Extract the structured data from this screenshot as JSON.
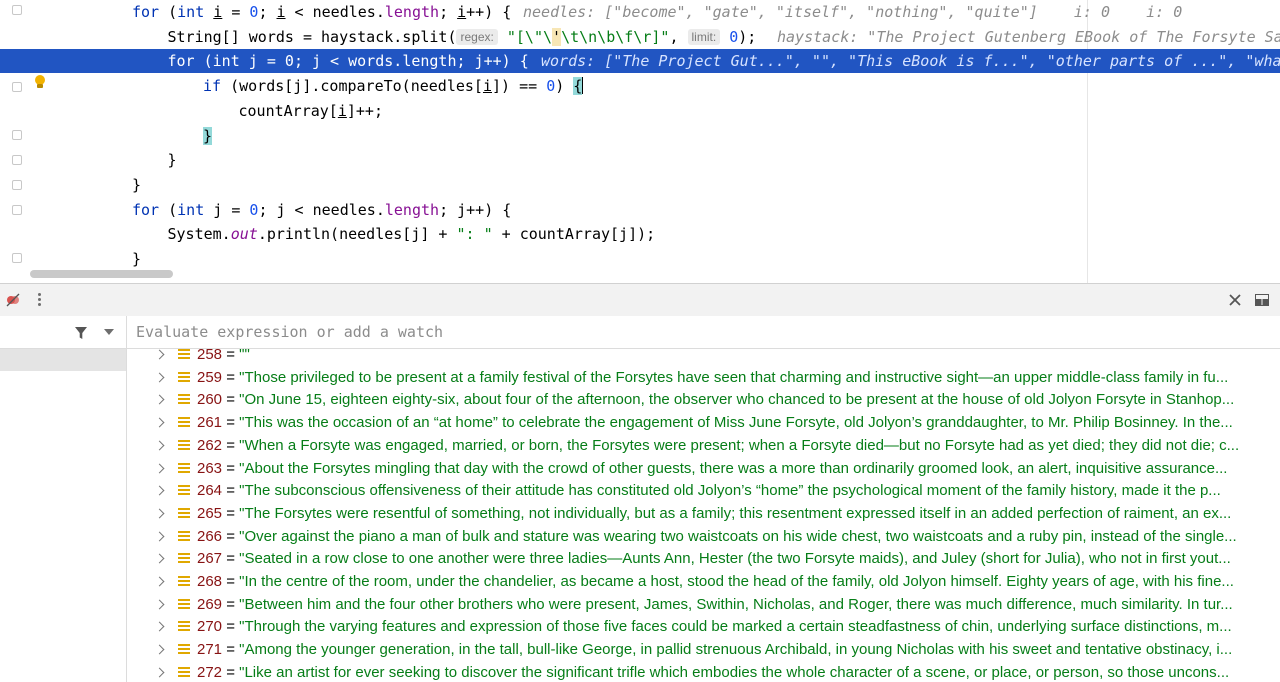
{
  "editor": {
    "lines": [
      {
        "id": "l1",
        "indent": 0,
        "tokens": [
          [
            "kw",
            "for"
          ],
          [
            "t",
            " ("
          ],
          [
            "kw",
            "int "
          ],
          [
            "ul",
            "i"
          ],
          [
            "t",
            " = "
          ],
          [
            "num",
            "0"
          ],
          [
            "t",
            "; "
          ],
          [
            "ul",
            "i"
          ],
          [
            "t",
            " < needles."
          ],
          [
            "fld",
            "length"
          ],
          [
            "t",
            "; "
          ],
          [
            "ul",
            "i"
          ],
          [
            "t",
            "++) {"
          ]
        ],
        "hint": "needles: [\"become\", \"gate\", \"itself\", \"nothing\", \"quite\"]    i: 0    i: 0"
      },
      {
        "id": "l2",
        "indent": 1,
        "tokens": [
          [
            "t",
            "String[] words = haystack.split("
          ],
          [
            "param",
            "regex:"
          ],
          [
            "str",
            " \"[\\\"\\"
          ],
          [
            "esc",
            "'"
          ],
          [
            "str",
            "\\t\\n\\b\\f\\r]\""
          ],
          [
            "t",
            ", "
          ],
          [
            "param",
            "limit:"
          ],
          [
            "t",
            " "
          ],
          [
            "num",
            "0"
          ],
          [
            "t",
            ");"
          ]
        ],
        "hint": "haystack: \"The Project Gutenberg EBook of The Forsyte Saga"
      },
      {
        "id": "l3",
        "indent": 1,
        "tokens": [
          [
            "kw",
            "for"
          ],
          [
            "t",
            " ("
          ],
          [
            "kw",
            "int "
          ],
          [
            "t",
            "j = "
          ],
          [
            "num",
            "0"
          ],
          [
            "t",
            "; j < words."
          ],
          [
            "fld",
            "length"
          ],
          [
            "t",
            "; j++) {"
          ]
        ],
        "hint": "words: [\"The Project Gut...\", \"\", \"This eBook is f...\", \"other parts of ...\", \"whats"
      },
      {
        "id": "l4",
        "indent": 2,
        "tokens": [
          [
            "kw",
            "if"
          ],
          [
            "t",
            " (words[j].compareTo(needles["
          ],
          [
            "ul",
            "i"
          ],
          [
            "t",
            "]) == "
          ],
          [
            "num",
            "0"
          ],
          [
            "t",
            ") "
          ],
          [
            "brace",
            "{"
          ],
          [
            "caret",
            ""
          ]
        ],
        "hint": ""
      },
      {
        "id": "l5",
        "indent": 3,
        "tokens": [
          [
            "t",
            "countArray["
          ],
          [
            "ul",
            "i"
          ],
          [
            "t",
            "]++;"
          ]
        ],
        "hint": ""
      },
      {
        "id": "l6",
        "indent": 2,
        "tokens": [
          [
            "brace",
            "}"
          ]
        ],
        "hint": ""
      },
      {
        "id": "l7",
        "indent": 1,
        "tokens": [
          [
            "t",
            "}"
          ]
        ],
        "hint": ""
      },
      {
        "id": "l8",
        "indent": 0,
        "tokens": [
          [
            "t",
            "}"
          ]
        ],
        "hint": ""
      },
      {
        "id": "l9",
        "indent": 0,
        "tokens": [
          [
            "kw",
            "for"
          ],
          [
            "t",
            " ("
          ],
          [
            "kw",
            "int "
          ],
          [
            "t",
            "j = "
          ],
          [
            "num",
            "0"
          ],
          [
            "t",
            "; j < needles."
          ],
          [
            "fld",
            "length"
          ],
          [
            "t",
            "; j++) {"
          ]
        ],
        "hint": ""
      },
      {
        "id": "l10",
        "indent": 1,
        "tokens": [
          [
            "t",
            "System."
          ],
          [
            "fldi",
            "out"
          ],
          [
            "t",
            ".println(needles[j] + "
          ],
          [
            "str",
            "\": \""
          ],
          [
            "t",
            " + countArray[j]);"
          ]
        ],
        "hint": ""
      },
      {
        "id": "l11",
        "indent": 0,
        "tokens": [
          [
            "t",
            "}"
          ]
        ],
        "hint": ""
      }
    ]
  },
  "watch": {
    "placeholder": "Evaluate expression or add a watch"
  },
  "variables": [
    {
      "index": "258",
      "value": "\"\""
    },
    {
      "index": "259",
      "value": "\"Those privileged to be present at a family festival of the Forsytes have seen that charming and instructive sight—an upper middle-class family in fu..."
    },
    {
      "index": "260",
      "value": "\"On June 15, eighteen eighty-six, about four of the afternoon, the observer who chanced to be present at the house of old Jolyon Forsyte in Stanhop..."
    },
    {
      "index": "261",
      "value": "\"This was the occasion of an “at home” to celebrate the engagement of Miss June Forsyte, old Jolyon’s granddaughter, to Mr. Philip Bosinney. In the..."
    },
    {
      "index": "262",
      "value": "\"When a Forsyte was engaged, married, or born, the Forsytes were present; when a Forsyte died—but no Forsyte had as yet died; they did not die; c..."
    },
    {
      "index": "263",
      "value": "\"About the Forsytes mingling that day with the crowd of other guests, there was a more than ordinarily groomed look, an alert, inquisitive assurance..."
    },
    {
      "index": "264",
      "value": "\"The subconscious offensiveness of their attitude has constituted old Jolyon’s “home” the psychological moment of the family history, made it the p..."
    },
    {
      "index": "265",
      "value": "\"The Forsytes were resentful of something, not individually, but as a family; this resentment expressed itself in an added perfection of raiment, an ex..."
    },
    {
      "index": "266",
      "value": "\"Over against the piano a man of bulk and stature was wearing two waistcoats on his wide chest, two waistcoats and a ruby pin, instead of the single..."
    },
    {
      "index": "267",
      "value": "\"Seated in a row close to one another were three ladies—Aunts Ann, Hester (the two Forsyte maids), and Juley (short for Julia), who not in first yout..."
    },
    {
      "index": "268",
      "value": "\"In the centre of the room, under the chandelier, as became a host, stood the head of the family, old Jolyon himself. Eighty years of age, with his fine..."
    },
    {
      "index": "269",
      "value": "\"Between him and the four other brothers who were present, James, Swithin, Nicholas, and Roger, there was much difference, much similarity. In tur..."
    },
    {
      "index": "270",
      "value": "\"Through the varying features and expression of those five faces could be marked a certain steadfastness of chin, underlying surface distinctions, m..."
    },
    {
      "index": "271",
      "value": "\"Among the younger generation, in the tall, bull-like George, in pallid strenuous Archibald, in young Nicholas with his sweet and tentative obstinacy, i..."
    },
    {
      "index": "272",
      "value": "\"Like an artist for ever seeking to discover the significant trifle which embodies the whole character of a scene, or place, or person, so those uncons..."
    }
  ]
}
